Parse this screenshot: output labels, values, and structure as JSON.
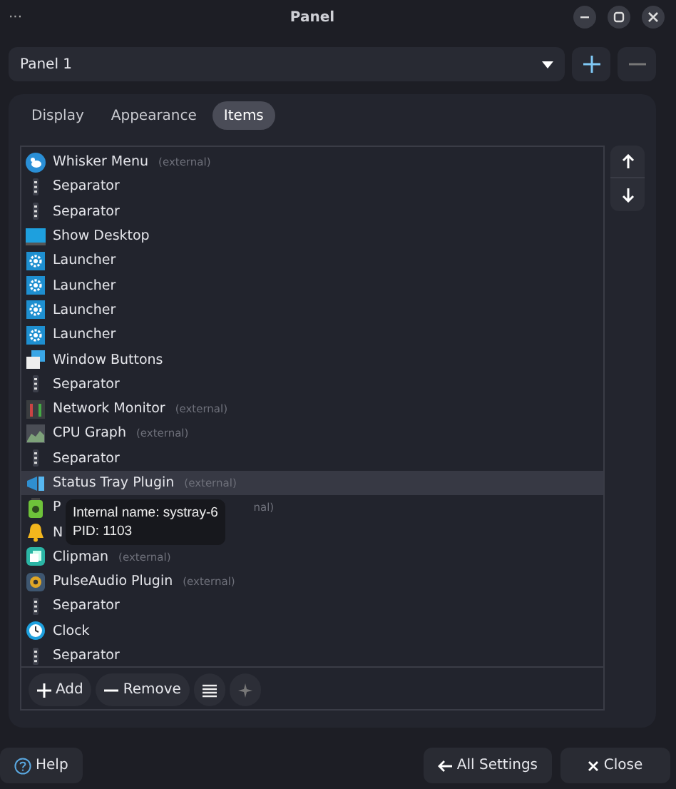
{
  "window": {
    "title": "Panel",
    "menu": "···"
  },
  "panel_select": {
    "value": "Panel 1"
  },
  "tabs": [
    {
      "label": "Display",
      "selected": false
    },
    {
      "label": "Appearance",
      "selected": false
    },
    {
      "label": "Items",
      "selected": true
    }
  ],
  "items": [
    {
      "kind": "whisker",
      "name": "Whisker Menu",
      "note": "(external)",
      "selected": false
    },
    {
      "kind": "separator",
      "name": "Separator",
      "selected": false
    },
    {
      "kind": "separator",
      "name": "Separator",
      "selected": false
    },
    {
      "kind": "desktop",
      "name": "Show Desktop",
      "selected": false
    },
    {
      "kind": "launcher",
      "name": "Launcher",
      "selected": false
    },
    {
      "kind": "launcher",
      "name": "Launcher",
      "selected": false
    },
    {
      "kind": "launcher",
      "name": "Launcher",
      "selected": false
    },
    {
      "kind": "launcher",
      "name": "Launcher",
      "selected": false
    },
    {
      "kind": "windows",
      "name": "Window Buttons",
      "selected": false
    },
    {
      "kind": "separator",
      "name": "Separator",
      "selected": false
    },
    {
      "kind": "netmon",
      "name": "Network Monitor",
      "note": "(external)",
      "selected": false
    },
    {
      "kind": "cpu",
      "name": "CPU Graph",
      "note": "(external)",
      "selected": false
    },
    {
      "kind": "separator",
      "name": "Separator",
      "selected": false
    },
    {
      "kind": "systray",
      "name": "Status Tray Plugin",
      "note": "(external)",
      "selected": true
    },
    {
      "kind": "power",
      "name": "P",
      "note": "nal)",
      "covered": true,
      "selected": false
    },
    {
      "kind": "bell",
      "name": "N",
      "selected": false
    },
    {
      "kind": "clipman",
      "name": "Clipman",
      "note": "(external)",
      "selected": false
    },
    {
      "kind": "pulse",
      "name": "PulseAudio Plugin",
      "note": "(external)",
      "selected": false
    },
    {
      "kind": "separator",
      "name": "Separator",
      "selected": false
    },
    {
      "kind": "clock",
      "name": "Clock",
      "selected": false
    },
    {
      "kind": "separator",
      "name": "Separator",
      "selected": false
    }
  ],
  "tooltip": {
    "lines": [
      "Internal name: systray-6",
      "PID: 1103"
    ]
  },
  "toolbar": {
    "add": "Add",
    "remove": "Remove"
  },
  "footer": {
    "help": "Help",
    "all_settings": "All Settings",
    "close": "Close"
  }
}
